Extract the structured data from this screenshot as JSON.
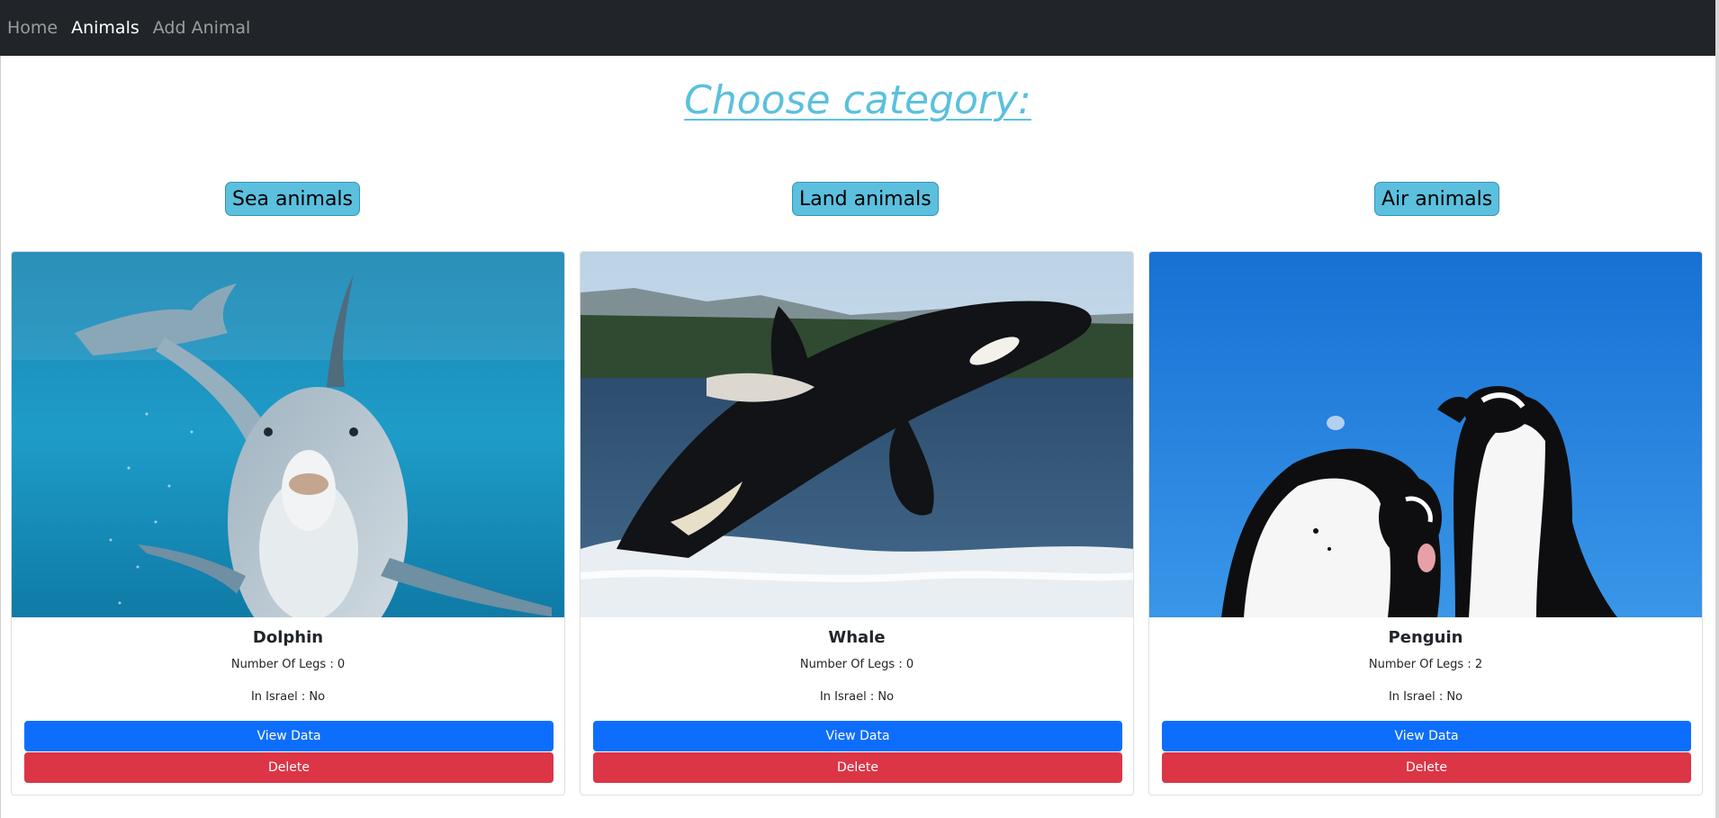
{
  "nav": {
    "items": [
      {
        "label": "Home",
        "active": false
      },
      {
        "label": "Animals",
        "active": true
      },
      {
        "label": "Add Animal",
        "active": false
      }
    ]
  },
  "page_title": "Choose category:",
  "categories": [
    "Sea animals",
    "Land animals",
    "Air animals"
  ],
  "cards": [
    {
      "name": "Dolphin",
      "legs": "Number Of Legs : 0",
      "in_israel": "In Israel : No",
      "view_label": "View Data",
      "delete_label": "Delete"
    },
    {
      "name": "Whale",
      "legs": "Number Of Legs : 0",
      "in_israel": "In Israel : No",
      "view_label": "View Data",
      "delete_label": "Delete"
    },
    {
      "name": "Penguin",
      "legs": "Number Of Legs : 2",
      "in_israel": "In Israel : No",
      "view_label": "View Data",
      "delete_label": "Delete"
    }
  ],
  "colors": {
    "navbar": "#212529",
    "title": "#5bc0de",
    "category_button": "#5bc0de",
    "view_button": "#0d6efd",
    "delete_button": "#dc3545"
  }
}
